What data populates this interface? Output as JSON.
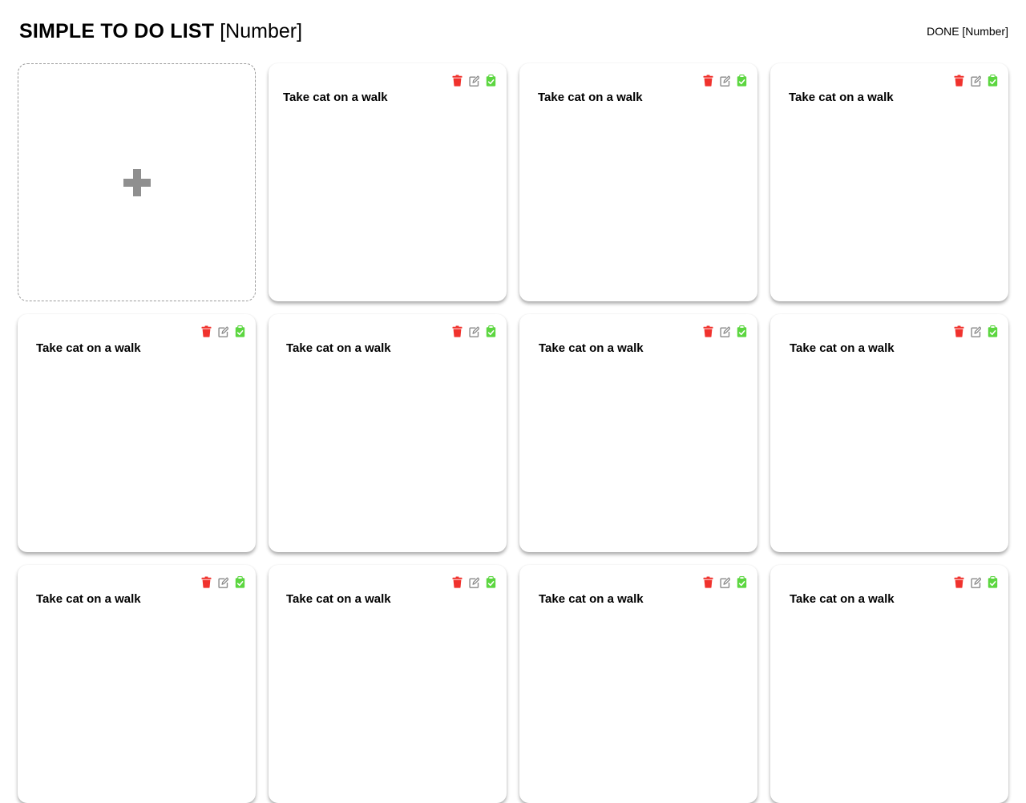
{
  "header": {
    "title": "SIMPLE TO DO LIST",
    "title_counter": "[Number]",
    "done_label": "DONE [Number]"
  },
  "add_card": {
    "icon": "plus-icon"
  },
  "task_actions": {
    "delete_icon": "trash-icon",
    "edit_icon": "edit-icon",
    "done_icon": "clipboard-check-icon",
    "colors": {
      "delete": "#f0322d",
      "edit": "#8a8a8a",
      "done": "#5cd640"
    }
  },
  "tasks": [
    {
      "text": "Take cat on a walk"
    },
    {
      "text": "Take cat on a walk"
    },
    {
      "text": "Take cat on a walk"
    },
    {
      "text": "Take cat on a walk"
    },
    {
      "text": "Take cat on a walk"
    },
    {
      "text": "Take cat on a walk"
    },
    {
      "text": "Take cat on a walk"
    },
    {
      "text": "Take cat on a walk"
    },
    {
      "text": "Take cat on a walk"
    },
    {
      "text": "Take cat on a walk"
    },
    {
      "text": "Take cat on a walk"
    }
  ]
}
